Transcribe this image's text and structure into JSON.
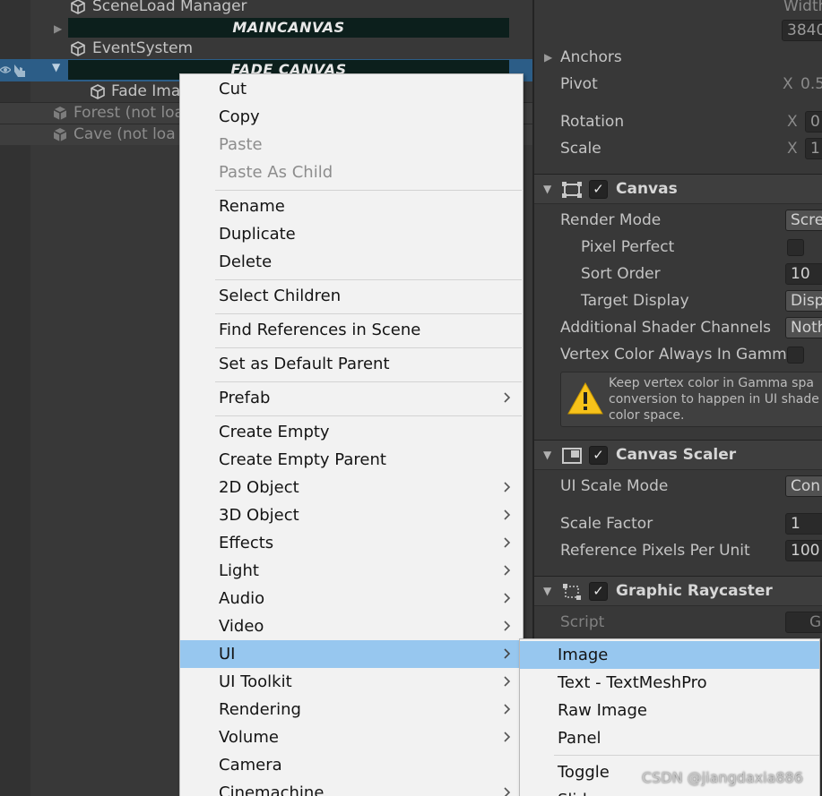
{
  "hierarchy": {
    "rows": {
      "sceneload_manager": "SceneLoad Manager",
      "event_system": "EventSystem",
      "fade_image": "Fade Ima"
    },
    "main_canvas": "MAINCANVAS",
    "fade_canvas": "FADE CANVAS",
    "scenes": {
      "forest": "Forest (not loa",
      "cave": "Cave (not loa"
    }
  },
  "inspector": {
    "width_label": "Width",
    "width_value": "3840",
    "anchors": "Anchors",
    "pivot": "Pivot",
    "pivot_x": "X",
    "pivot_value": "0.5",
    "rotation": "Rotation",
    "rotation_x": "X",
    "rotation_value": "0",
    "scale": "Scale",
    "scale_x": "X",
    "scale_value": "1",
    "canvas": {
      "title": "Canvas",
      "render_mode": "Render Mode",
      "render_mode_value": "Scre",
      "pixel_perfect": "Pixel Perfect",
      "sort_order": "Sort Order",
      "sort_order_value": "10",
      "target_display": "Target Display",
      "target_display_value": "Disp",
      "additional_shader_channels": "Additional Shader Channels",
      "additional_shader_channels_value": "Noth",
      "vertex_color_gamma": "Vertex Color Always In Gamm",
      "warning": "Keep vertex color in Gamma spa\nconversion to happen in UI shade\ncolor space."
    },
    "canvas_scaler": {
      "title": "Canvas Scaler",
      "ui_scale_mode": "UI Scale Mode",
      "ui_scale_mode_value": "Con",
      "scale_factor": "Scale Factor",
      "scale_factor_value": "1",
      "reference_pixels": "Reference Pixels Per Unit",
      "reference_pixels_value": "100"
    },
    "graphic_raycaster": {
      "title": "Graphic Raycaster",
      "script": "Script",
      "script_value": "G"
    }
  },
  "context_menu": {
    "cut": "Cut",
    "copy": "Copy",
    "paste": "Paste",
    "paste_as_child": "Paste As Child",
    "rename": "Rename",
    "duplicate": "Duplicate",
    "delete": "Delete",
    "select_children": "Select Children",
    "find_references": "Find References in Scene",
    "set_default_parent": "Set as Default Parent",
    "prefab": "Prefab",
    "create_empty": "Create Empty",
    "create_empty_parent": "Create Empty Parent",
    "object_2d": "2D Object",
    "object_3d": "3D Object",
    "effects": "Effects",
    "light": "Light",
    "audio": "Audio",
    "video": "Video",
    "ui": "UI",
    "ui_toolkit": "UI Toolkit",
    "rendering": "Rendering",
    "volume": "Volume",
    "camera": "Camera",
    "cinemachine": "Cinemachine"
  },
  "ui_submenu": {
    "image": "Image",
    "text_tmp": "Text - TextMeshPro",
    "raw_image": "Raw Image",
    "panel": "Panel",
    "toggle": "Toggle",
    "slider": "Slider"
  },
  "watermark": "CSDN @jiangdaxia886",
  "colors": {
    "menu_highlight": "#97c7ef",
    "selection": "#2c5d87",
    "canvas_bar": "#0c1f1c"
  }
}
